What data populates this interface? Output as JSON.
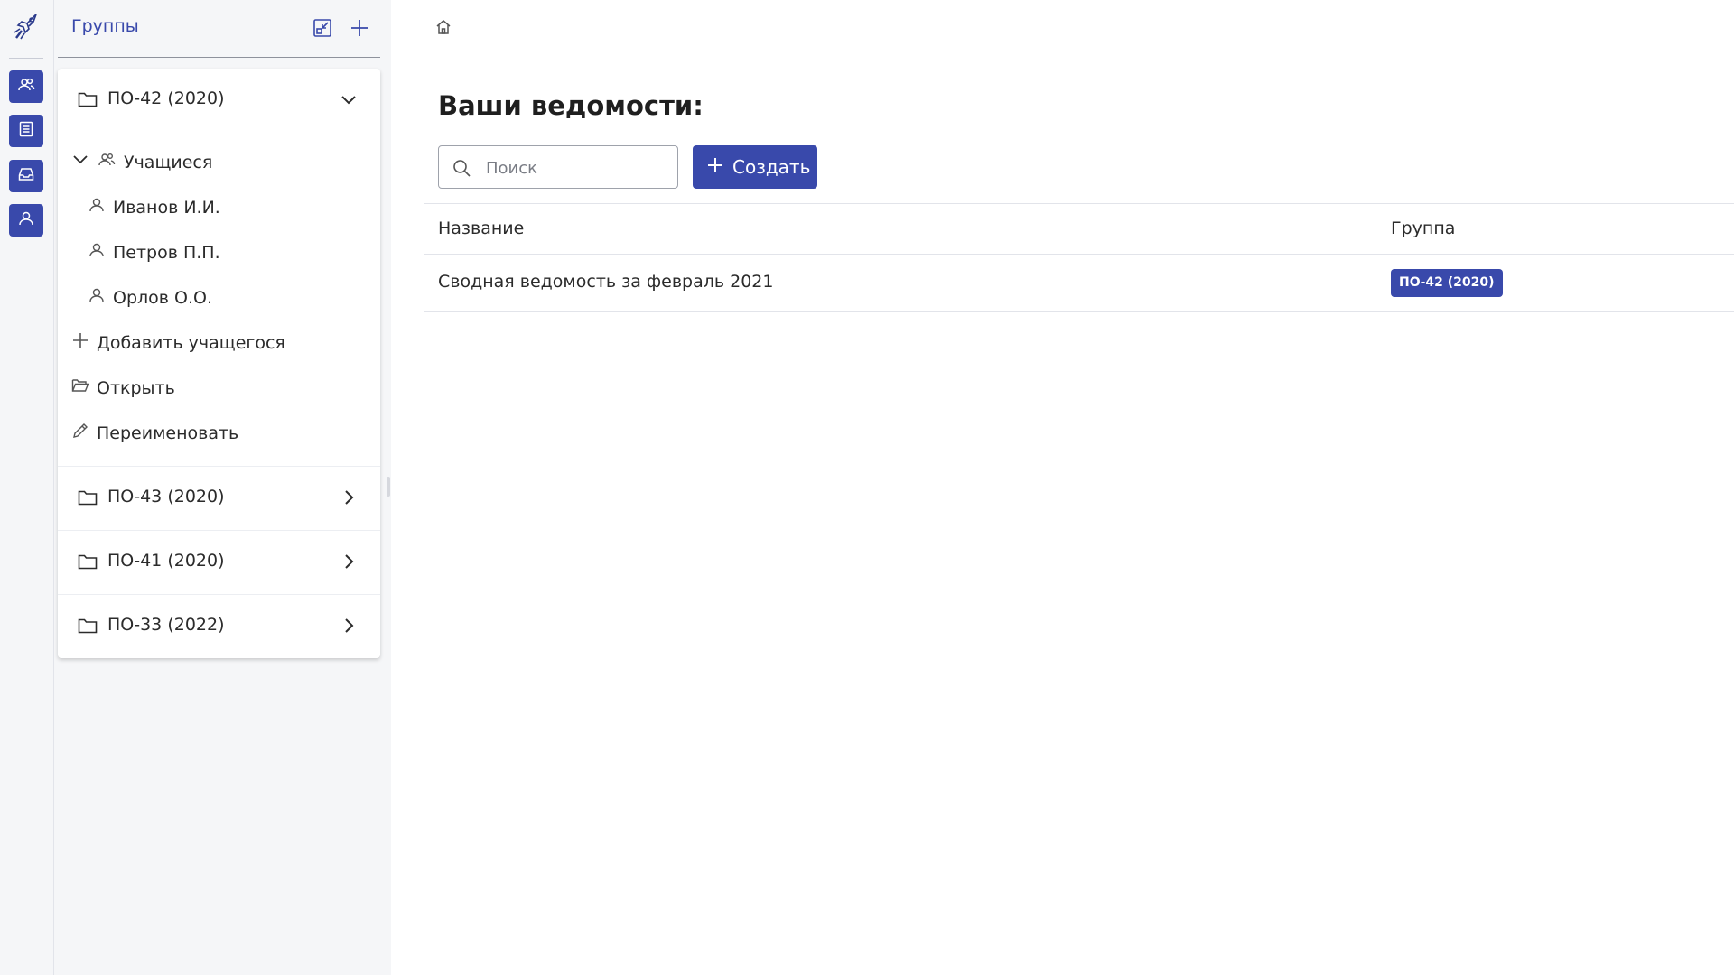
{
  "colors": {
    "accent": "#3949ab",
    "rail_bg": "#f5f6f8",
    "text": "#2b2b2b"
  },
  "rail": {
    "logo_icon": "rocket-logo-icon",
    "items": [
      {
        "icon": "users-icon",
        "name": "rail-groups-button"
      },
      {
        "icon": "document-icon",
        "name": "rail-sheets-button"
      },
      {
        "icon": "inbox-icon",
        "name": "rail-inbox-button"
      },
      {
        "icon": "user-icon",
        "name": "rail-profile-button"
      }
    ]
  },
  "groups_panel": {
    "title": "Группы",
    "expanded_group": {
      "label": "ПО-42 (2020)",
      "students_label": "Учащиеся",
      "students": [
        "Иванов И.И.",
        "Петров П.П.",
        "Орлов О.О."
      ],
      "actions": {
        "add_student": "Добавить учащегося",
        "open": "Открыть",
        "rename": "Переименовать"
      }
    },
    "collapsed_groups": [
      "ПО-43 (2020)",
      "ПО-41 (2020)",
      "ПО-33 (2022)"
    ]
  },
  "main": {
    "title": "Ваши ведомости:",
    "search": {
      "placeholder": "Поиск",
      "value": ""
    },
    "create_label": "Создать",
    "table": {
      "headers": {
        "name": "Название",
        "group": "Группа"
      },
      "rows": [
        {
          "name": "Сводная ведомость за февраль 2021",
          "group": "ПО-42 (2020)"
        }
      ]
    }
  }
}
